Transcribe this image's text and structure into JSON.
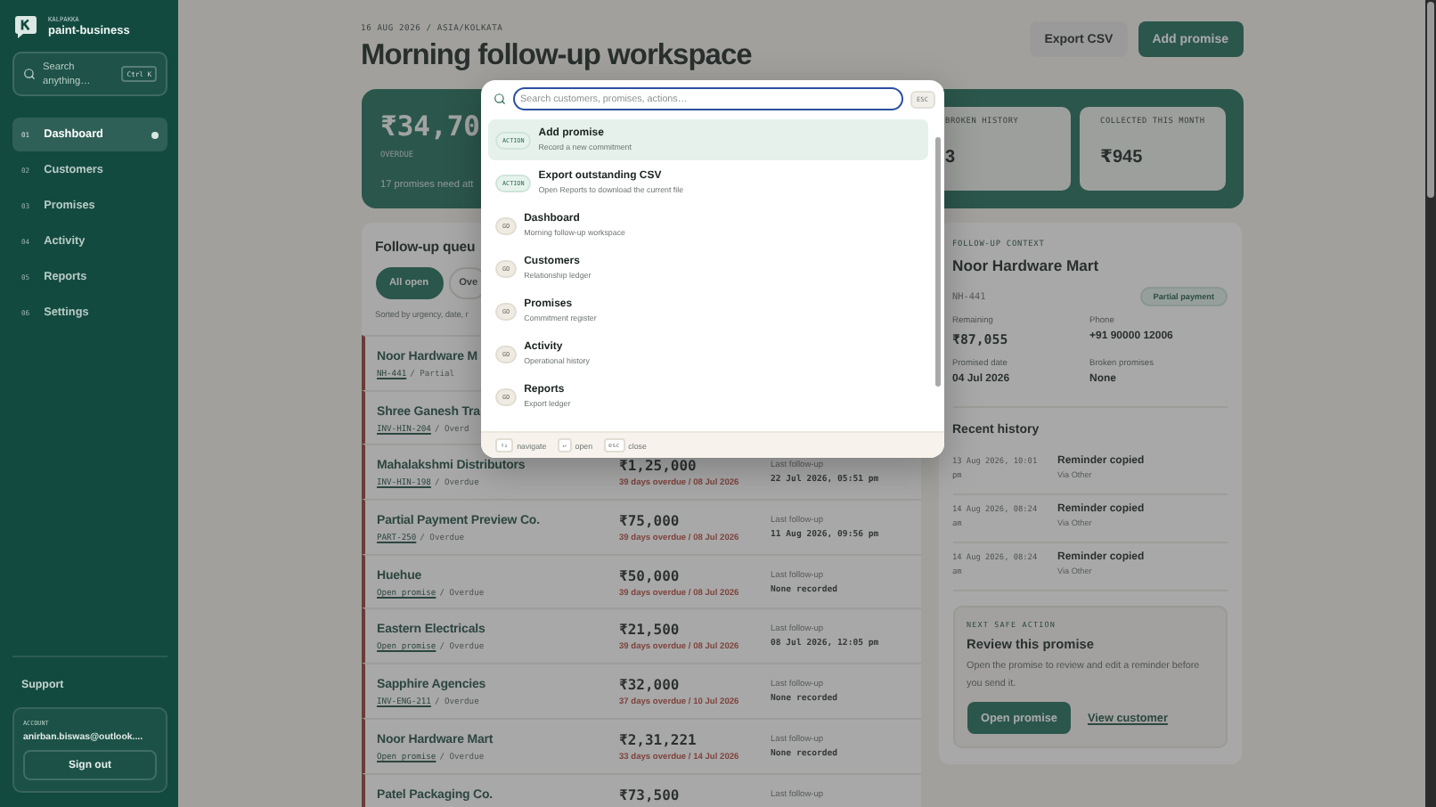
{
  "sidebar": {
    "brand_caption": "KALPAKKA",
    "workspace": "paint-business",
    "search": {
      "placeholder": "Search anything…",
      "shortcut": "Ctrl K"
    },
    "nav": [
      {
        "number": "01",
        "label": "Dashboard",
        "selected": true
      },
      {
        "number": "02",
        "label": "Customers",
        "selected": false
      },
      {
        "number": "03",
        "label": "Promises",
        "selected": false
      },
      {
        "number": "04",
        "label": "Activity",
        "selected": false
      },
      {
        "number": "05",
        "label": "Reports",
        "selected": false
      },
      {
        "number": "06",
        "label": "Settings",
        "selected": false
      }
    ],
    "support": "Support",
    "account": {
      "caption": "ACCOUNT",
      "email": "anirban.biswas@outlook....",
      "button": "Sign out"
    }
  },
  "header": {
    "eyebrow": "16 AUG 2026 / ASIA/KOLKATA",
    "title": "Morning follow-up workspace",
    "buttons": [
      {
        "label": "Export CSV",
        "kind": "secondary"
      },
      {
        "label": "Add promise",
        "kind": "primary"
      }
    ]
  },
  "summary": {
    "amount": "₹34,70",
    "label": "OVERDUE",
    "note": "17 promises need att",
    "cards": [
      {
        "label": "BROKEN HISTORY",
        "value": "3"
      },
      {
        "label": "COLLECTED THIS MONTH",
        "value": "₹945"
      }
    ]
  },
  "queue": {
    "title": "Follow-up queu",
    "filters": [
      {
        "label": "All open",
        "selected": true
      },
      {
        "label": "Ove",
        "selected": false
      }
    ],
    "sort_note": "Sorted by urgency, date, r",
    "rows": [
      {
        "name": "Noor Hardware M",
        "ref": "NH-441",
        "status": "/ Partial"
      },
      {
        "name": "Shree Ganesh Tra",
        "ref": "INV-HIN-204",
        "status": "/ Overd"
      },
      {
        "name": "Mahalakshmi Distributors",
        "ref": "INV-HIN-198",
        "status": "/ Overdue",
        "amount": "₹1,25,000",
        "due": "39 days overdue / 08 Jul 2026",
        "followup_label": "Last follow-up",
        "followup": "22 Jul 2026, 05:51 pm"
      },
      {
        "name": "Partial Payment Preview Co.",
        "ref": "PART-250",
        "status": "/ Overdue",
        "amount": "₹75,000",
        "due": "39 days overdue / 08 Jul 2026",
        "followup_label": "Last follow-up",
        "followup": "11 Aug 2026, 09:56 pm"
      },
      {
        "name": "Huehue",
        "ref": "Open promise",
        "status": "/ Overdue",
        "amount": "₹50,000",
        "due": "39 days overdue / 08 Jul 2026",
        "followup_label": "Last follow-up",
        "followup": "None recorded"
      },
      {
        "name": "Eastern Electricals",
        "ref": "Open promise",
        "status": "/ Overdue",
        "amount": "₹21,500",
        "due": "39 days overdue / 08 Jul 2026",
        "followup_label": "Last follow-up",
        "followup": "08 Jul 2026, 12:05 pm"
      },
      {
        "name": "Sapphire Agencies",
        "ref": "INV-ENG-211",
        "status": "/ Overdue",
        "amount": "₹32,000",
        "due": "37 days overdue / 10 Jul 2026",
        "followup_label": "Last follow-up",
        "followup": "None recorded"
      },
      {
        "name": "Noor Hardware Mart",
        "ref": "Open promise",
        "status": "/ Overdue",
        "amount": "₹2,31,221",
        "due": "33 days overdue / 14 Jul 2026",
        "followup_label": "Last follow-up",
        "followup": "None recorded"
      },
      {
        "name": "Patel Packaging Co.",
        "amount": "₹73,500",
        "followup_label": "Last follow-up"
      }
    ]
  },
  "context": {
    "eyebrow": "FOLLOW-UP CONTEXT",
    "name": "Noor Hardware Mart",
    "ref": "NH-441",
    "badge": "Partial payment",
    "facts": [
      {
        "label": "Remaining",
        "value": "₹87,055",
        "kind": "money"
      },
      {
        "label": "Phone",
        "value": "+91 90000 12006",
        "kind": "text"
      },
      {
        "label": "Promised date",
        "value": "04 Jul 2026",
        "kind": "text"
      },
      {
        "label": "Broken promises",
        "value": "None",
        "kind": "text"
      }
    ],
    "history_title": "Recent history",
    "history": [
      {
        "time": "13 Aug 2026, 10:01 pm",
        "event": "Reminder copied",
        "channel": "Via Other"
      },
      {
        "time": "14 Aug 2026, 08:24 am",
        "event": "Reminder copied",
        "channel": "Via Other"
      },
      {
        "time": "14 Aug 2026, 08:24 am",
        "event": "Reminder copied",
        "channel": "Via Other"
      }
    ],
    "next_action": {
      "eyebrow": "NEXT SAFE ACTION",
      "title": "Review this promise",
      "text": "Open the promise to review and edit a reminder before you send it.",
      "primary": "Open promise",
      "link": "View customer"
    }
  },
  "command_palette": {
    "placeholder": "Search customers, promises, actions…",
    "escape": "ESC",
    "items": [
      {
        "kind": "action",
        "badge": "ACTION",
        "title": "Add promise",
        "subtitle": "Record a new commitment",
        "selected": true
      },
      {
        "kind": "action",
        "badge": "ACTION",
        "title": "Export outstanding CSV",
        "subtitle": "Open Reports to download the current file",
        "selected": false
      },
      {
        "kind": "go",
        "badge": "GO",
        "title": "Dashboard",
        "subtitle": "Morning follow-up workspace",
        "selected": false
      },
      {
        "kind": "go",
        "badge": "GO",
        "title": "Customers",
        "subtitle": "Relationship ledger",
        "selected": false
      },
      {
        "kind": "go",
        "badge": "GO",
        "title": "Promises",
        "subtitle": "Commitment register",
        "selected": false
      },
      {
        "kind": "go",
        "badge": "GO",
        "title": "Activity",
        "subtitle": "Operational history",
        "selected": false
      },
      {
        "kind": "go",
        "badge": "GO",
        "title": "Reports",
        "subtitle": "Export ledger",
        "selected": false
      }
    ],
    "hints": [
      {
        "key": "↑↓",
        "label": "navigate"
      },
      {
        "key": "↵",
        "label": "open"
      },
      {
        "key": "esc",
        "label": "close"
      }
    ]
  }
}
